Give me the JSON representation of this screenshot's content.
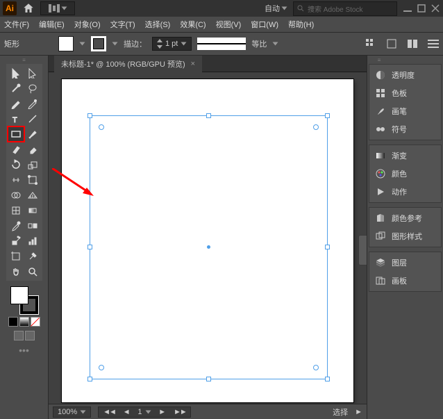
{
  "app": {
    "logo": "Ai"
  },
  "topbar": {
    "auto": "自动",
    "search_placeholder": "捜索 Adobe Stock"
  },
  "menu": {
    "file": "文件(F)",
    "edit": "编辑(E)",
    "object": "对象(O)",
    "type": "文字(T)",
    "select": "选择(S)",
    "effect": "效果(C)",
    "view": "视图(V)",
    "window": "窗口(W)",
    "help": "帮助(H)"
  },
  "control": {
    "shape": "矩形",
    "stroke_label": "描边：",
    "stroke_value": "1 pt",
    "uniform": "等比"
  },
  "tab": {
    "title": "未标题-1* @ 100% (RGB/GPU 预览)",
    "close": "×"
  },
  "status": {
    "zoom": "100%",
    "nav_value": "1",
    "mode": "选择"
  },
  "panels": {
    "opacity": "透明度",
    "swatches": "色板",
    "brushes": "画笔",
    "symbols": "符号",
    "gradient": "渐变",
    "color": "颜色",
    "actions": "动作",
    "colorguide": "颜色参考",
    "graphicstyles": "图形样式",
    "layers": "图层",
    "artboards": "画板"
  }
}
